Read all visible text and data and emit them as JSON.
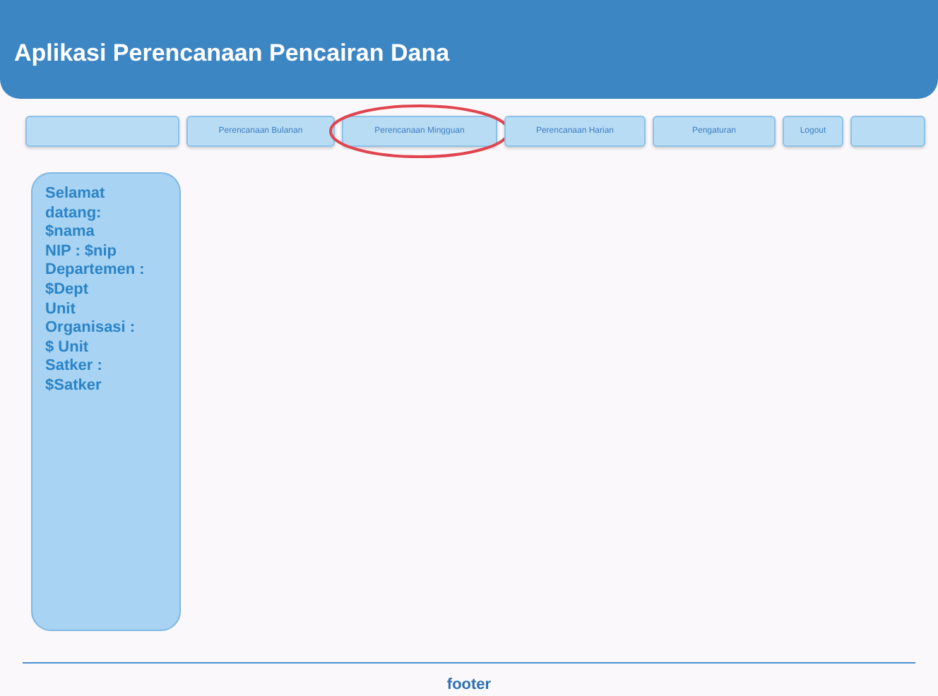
{
  "header": {
    "title": "Aplikasi Perencanaan Pencairan Dana"
  },
  "nav": [
    {
      "kind": "blank"
    },
    {
      "kind": "link",
      "label": "Perencanaan Bulanan",
      "highlighted": false
    },
    {
      "kind": "link",
      "label": "Perencanaan Mingguan",
      "highlighted": true
    },
    {
      "kind": "link",
      "label": "Perencanaan Harian",
      "highlighted": false
    },
    {
      "kind": "link",
      "label": "Pengaturan",
      "highlighted": false
    },
    {
      "kind": "link",
      "label": "Logout",
      "highlighted": false
    },
    {
      "kind": "blank"
    }
  ],
  "sidebar": {
    "lines": [
      "Selamat datang:",
      "$nama",
      "NIP : $nip",
      "Departemen :",
      "$Dept",
      "Unit Organisasi :",
      "$ Unit",
      "Satker :",
      "$Satker"
    ]
  },
  "footer": {
    "text": "footer"
  }
}
